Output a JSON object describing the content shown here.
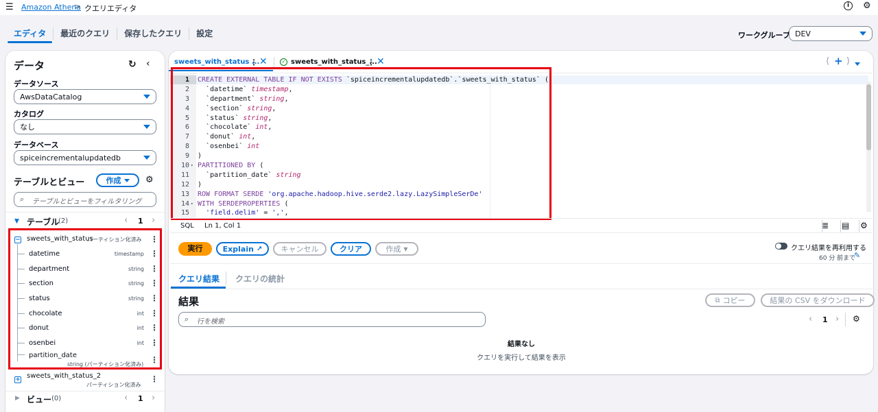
{
  "topbar": {
    "service_link": "Amazon Athena",
    "separator": ">",
    "current_page": "クエリエディタ"
  },
  "main_tabs": [
    {
      "label": "エディタ",
      "active": true
    },
    {
      "label": "最近のクエリ",
      "active": false
    },
    {
      "label": "保存したクエリ",
      "active": false
    },
    {
      "label": "設定",
      "active": false
    }
  ],
  "workgroup": {
    "label": "ワークグループ",
    "value": "DEV"
  },
  "data_panel": {
    "title": "データ",
    "datasource_label": "データソース",
    "datasource_value": "AwsDataCatalog",
    "catalog_label": "カタログ",
    "catalog_value": "なし",
    "database_label": "データベース",
    "database_value": "spiceincrementalupdatedb",
    "tables_views_title": "テーブルとビュー",
    "create_button": "作成",
    "filter_placeholder": "テーブルとビューをフィルタリング",
    "tables_section": {
      "label": "テーブル",
      "count": "(2)",
      "page": "1"
    },
    "table1": {
      "name": "sweets_with_status",
      "badge": "パーティション化済み",
      "columns": [
        {
          "name": "datetime",
          "type": "timestamp"
        },
        {
          "name": "department",
          "type": "string"
        },
        {
          "name": "section",
          "type": "string"
        },
        {
          "name": "status",
          "type": "string"
        },
        {
          "name": "chocolate",
          "type": "int"
        },
        {
          "name": "donut",
          "type": "int"
        },
        {
          "name": "osenbei",
          "type": "int"
        },
        {
          "name": "partition_date",
          "type": "string (パーティション化済み)"
        }
      ]
    },
    "table2": {
      "name": "sweets_with_status_2",
      "badge": "パーティション化済み"
    },
    "views_section": {
      "label": "ビュー",
      "count": "(0)",
      "page": "1"
    }
  },
  "editor": {
    "tabs": [
      {
        "label": "sweets_with_status ...",
        "active": true
      },
      {
        "label": "sweets_with_status_...",
        "active": false
      }
    ],
    "add_tab": "+",
    "lines": [
      {
        "n": "1",
        "text": "CREATE EXTERNAL TABLE IF NOT EXISTS `spiceincrementalupdatedb`.`sweets_with_status` ("
      },
      {
        "n": "2",
        "text": "  `datetime` timestamp,"
      },
      {
        "n": "3",
        "text": "  `department` string,"
      },
      {
        "n": "4",
        "text": "  `section` string,"
      },
      {
        "n": "5",
        "text": "  `status` string,"
      },
      {
        "n": "6",
        "text": "  `chocolate` int,"
      },
      {
        "n": "7",
        "text": "  `donut` int,"
      },
      {
        "n": "8",
        "text": "  `osenbei` int"
      },
      {
        "n": "9",
        "text": ")"
      },
      {
        "n": "10",
        "text": "PARTITIONED BY ("
      },
      {
        "n": "11",
        "text": "  `partition_date` string"
      },
      {
        "n": "12",
        "text": ")"
      },
      {
        "n": "13",
        "text": "ROW FORMAT SERDE 'org.apache.hadoop.hive.serde2.lazy.LazySimpleSerDe'"
      },
      {
        "n": "14",
        "text": "WITH SERDEPROPERTIES ("
      },
      {
        "n": "15",
        "text": "  'field.delim' = ',',"
      }
    ],
    "status_lang": "SQL",
    "status_pos": "Ln 1, Col 1"
  },
  "actions": {
    "run": "実行",
    "explain": "Explain",
    "cancel": "キャンセル",
    "clear": "クリア",
    "create": "作成",
    "reuse_label": "クエリ結果を再利用する",
    "reuse_sub": "60 分 前まで"
  },
  "results": {
    "tabs": [
      {
        "label": "クエリ結果",
        "active": true
      },
      {
        "label": "クエリの統計",
        "active": false
      }
    ],
    "title": "結果",
    "copy": "コピー",
    "download": "結果の CSV をダウンロード",
    "search_placeholder": "行を検索",
    "page": "1",
    "empty_title": "結果なし",
    "empty_sub": "クエリを実行して結果を表示"
  },
  "colors": {
    "accent": "#0972d3",
    "run": "#ff9900",
    "highlight": "#e60012",
    "success": "#037f0c"
  }
}
